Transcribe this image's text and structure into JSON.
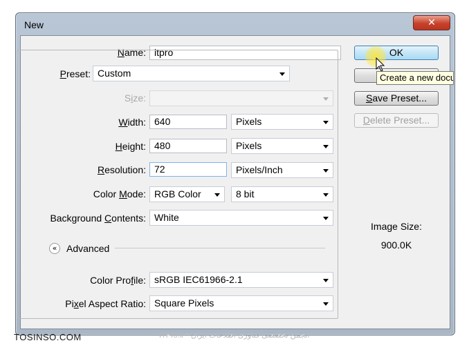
{
  "window": {
    "title": "New",
    "close_glyph": "✕"
  },
  "fields": {
    "name": {
      "label_pre": "",
      "label_u": "N",
      "label_post": "ame:",
      "value": "itpro"
    },
    "preset": {
      "label_pre": "",
      "label_u": "P",
      "label_post": "reset:",
      "value": "Custom"
    },
    "size": {
      "label_pre": "S",
      "label_u": "i",
      "label_post": "ze:",
      "value": ""
    },
    "width": {
      "label_pre": "",
      "label_u": "W",
      "label_post": "idth:",
      "value": "640",
      "unit": "Pixels"
    },
    "height": {
      "label_pre": "",
      "label_u": "H",
      "label_post": "eight:",
      "value": "480",
      "unit": "Pixels"
    },
    "resolution": {
      "label_pre": "",
      "label_u": "R",
      "label_post": "esolution:",
      "value": "72",
      "unit": "Pixels/Inch"
    },
    "color_mode": {
      "label_pre": "Color ",
      "label_u": "M",
      "label_post": "ode:",
      "value": "RGB Color",
      "depth": "8 bit"
    },
    "background": {
      "label_pre": "Background ",
      "label_u": "C",
      "label_post": "ontents:",
      "value": "White"
    },
    "advanced": {
      "label": "Advanced",
      "icon": "«"
    },
    "color_profile": {
      "label_pre": "Color Pro",
      "label_u": "f",
      "label_post": "ile:",
      "value": "sRGB IEC61966-2.1"
    },
    "pixel_aspect": {
      "label_pre": "Pi",
      "label_u": "x",
      "label_post": "el Aspect Ratio:",
      "value": "Square Pixels"
    }
  },
  "buttons": {
    "ok": "OK",
    "save_preset": {
      "pre": "",
      "u": "S",
      "post": "ave Preset..."
    },
    "delete_preset": {
      "pre": "",
      "u": "D",
      "post": "elete Preset..."
    }
  },
  "tooltip": "Create a new document",
  "image_size": {
    "label": "Image Size:",
    "value": "900.0K"
  },
  "watermark": {
    "left": "TOSINSO.COM",
    "center": "ITPro.ir - انجمن تخصصی فناوری اطلاعات ایران"
  },
  "colors": {
    "ok_accent": "#a9daf3",
    "cursor_highlight": "#ffe63c",
    "close_button": "#c7412b"
  }
}
